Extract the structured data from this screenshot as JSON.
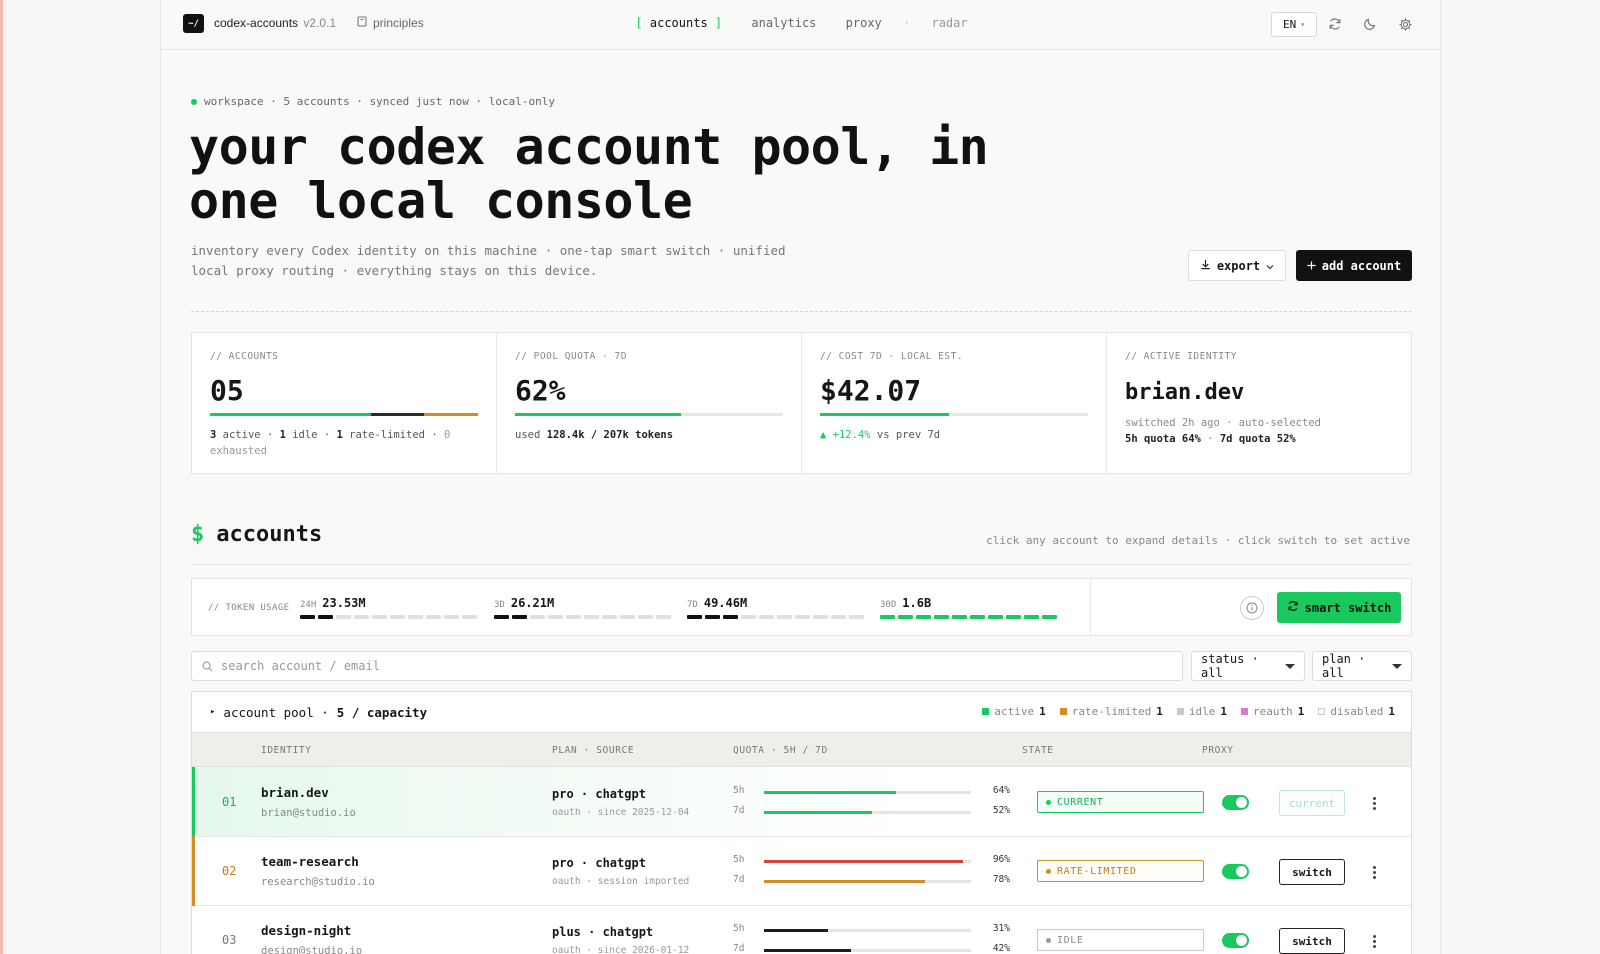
{
  "nav": {
    "logo": "~/",
    "app_name": "codex-accounts",
    "version": "v2.0.1",
    "principles": "principles",
    "links": {
      "accounts": "accounts",
      "bracket_open": "[",
      "bracket_close": "]",
      "analytics": "analytics",
      "proxy": "proxy",
      "separator": "·",
      "radar": "radar"
    },
    "lang": "EN",
    "lang_caret": "▾"
  },
  "hero": {
    "eyebrow": "workspace · 5 accounts · synced just now · local-only",
    "title": "your codex account pool, in one local console",
    "subtitle": "inventory every Codex identity on this machine · one-tap smart switch · unified local proxy routing · everything stays on this device.",
    "export_label": "export",
    "add_label": "add account"
  },
  "stats": {
    "accounts": {
      "label": "// ACCOUNTS",
      "value": "05",
      "note_html_parts": [
        "3",
        "active ·",
        "1",
        "idle ·",
        "1",
        "rate-limited ·",
        "0",
        "exhausted"
      ],
      "bar": [
        {
          "frac": 0.6,
          "color": "#19c95e"
        },
        {
          "frac": 0.2,
          "color": "#2b2b2b"
        },
        {
          "frac": 0.2,
          "color": "#d48d22"
        }
      ]
    },
    "pool_quota": {
      "label": "// POOL QUOTA · 7D",
      "value": "62%",
      "note_prefix": "used",
      "note_value": "128.4k / 207k tokens",
      "fill": 0.62
    },
    "cost": {
      "label": "// COST 7D · LOCAL EST.",
      "value": "$42.07",
      "delta": "▲ +12.4%",
      "delta_suffix": "vs prev 7d",
      "fill": 0.48
    },
    "identity": {
      "label": "// ACTIVE IDENTITY",
      "value": "brian.dev",
      "line1": "switched 2h ago · auto-selected",
      "line2_a": "5h quota",
      "line2_b": "64%",
      "line2_c": "·",
      "line2_d": "7d quota",
      "line2_e": "52%"
    }
  },
  "accounts_section": {
    "prompt": "$",
    "title": "accounts",
    "hint": "click any account to expand details · click switch to set active"
  },
  "token_usage": {
    "label": "// TOKEN USAGE",
    "periods": [
      {
        "period": "24H",
        "value": "23.53M",
        "segments": 10,
        "filled": 2,
        "color": "k"
      },
      {
        "period": "3D",
        "value": "26.21M",
        "segments": 10,
        "filled": 2,
        "color": "k"
      },
      {
        "period": "7D",
        "value": "49.46M",
        "segments": 10,
        "filled": 3,
        "color": "k"
      },
      {
        "period": "30D",
        "value": "1.6B",
        "segments": 10,
        "filled": 10,
        "color": "g"
      }
    ],
    "smart_switch_label": "smart switch"
  },
  "filters": {
    "search_placeholder": "search account / email",
    "status_label": "status · all",
    "plan_label": "plan · all"
  },
  "pool": {
    "toggle": "▸",
    "title": "account pool ·",
    "capacity": "5 / capacity",
    "legend": [
      {
        "label": "active",
        "count": "1",
        "color": "#19c95e",
        "outline": false
      },
      {
        "label": "rate-limited",
        "count": "1",
        "color": "#d48d22",
        "outline": false
      },
      {
        "label": "idle",
        "count": "1",
        "color": "#c8c8c5",
        "outline": false
      },
      {
        "label": "reauth",
        "count": "1",
        "color": "#d77ad0",
        "outline": false
      },
      {
        "label": "disabled",
        "count": "1",
        "color": "#c8c8c5",
        "outline": true
      }
    ],
    "columns": {
      "identity": "IDENTITY",
      "plan": "PLAN · SOURCE",
      "quota": "QUOTA · 5H / 7D",
      "state": "STATE",
      "proxy": "PROXY"
    },
    "q5_label": "5h",
    "q7_label": "7d",
    "rows": [
      {
        "num": "01",
        "name": "brian.dev",
        "email": "brian@studio.io",
        "plan": "pro · chatgpt",
        "source": "oauth · since 2025-12-04",
        "q5": 0.64,
        "q5_text": "64%",
        "q5_color": "#19c95e",
        "q7": 0.52,
        "q7_text": "52%",
        "q7_color": "#19c95e",
        "state": "CURRENT",
        "state_color": "#19c95e",
        "state_text_color": "#19b455",
        "state_bg": "#f3fcf6",
        "accent": "#19c95e",
        "num_color": "#19b455",
        "action": "current",
        "is_current": true
      },
      {
        "num": "02",
        "name": "team-research",
        "email": "research@studio.io",
        "plan": "pro · chatgpt",
        "source": "oauth · session imported",
        "q5": 0.96,
        "q5_text": "96%",
        "q5_color": "#d9403a",
        "q7": 0.78,
        "q7_text": "78%",
        "q7_color": "#d48d22",
        "state": "RATE-LIMITED",
        "state_color": "#d48d22",
        "state_text_color": "#c57f18",
        "state_bg": "#fffdf8",
        "accent": "#d48d22",
        "num_color": "#c57f18",
        "action": "switch",
        "is_current": false
      },
      {
        "num": "03",
        "name": "design-night",
        "email": "design@studio.io",
        "plan": "plus · chatgpt",
        "source": "oauth · since 2026-01-12",
        "q5": 0.31,
        "q5_text": "31%",
        "q5_color": "#1e1e1e",
        "q7": 0.42,
        "q7_text": "42%",
        "q7_color": "#1e1e1e",
        "state": "IDLE",
        "state_color": "#c9c9c6",
        "state_text_color": "#888888",
        "state_bg": "#ffffff",
        "accent": "transparent",
        "num_color": "#777777",
        "action": "switch",
        "is_current": false
      }
    ]
  }
}
